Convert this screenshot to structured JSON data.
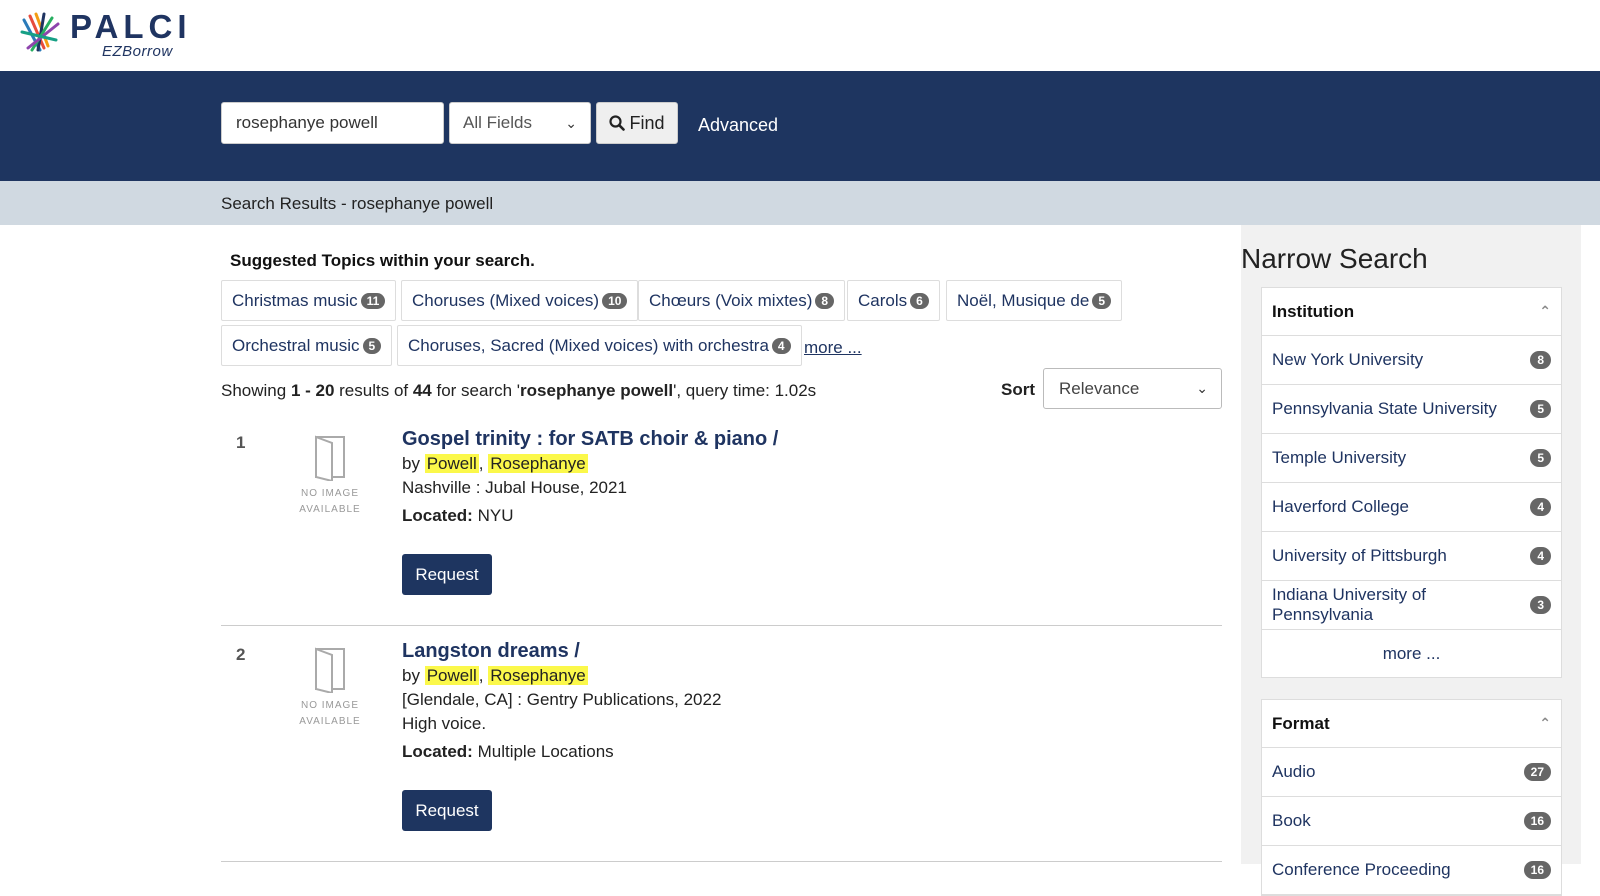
{
  "brand": {
    "title": "PALCI",
    "subtitle": "EZBorrow"
  },
  "search": {
    "query": "rosephanye powell",
    "field": "All Fields",
    "find_label": "Find",
    "advanced_label": "Advanced"
  },
  "breadcrumb": "Search Results - rosephanye powell",
  "suggested": {
    "title": "Suggested Topics within your search.",
    "topics": [
      {
        "label": "Christmas music",
        "count": "11"
      },
      {
        "label": "Choruses (Mixed voices)",
        "count": "10"
      },
      {
        "label": "Chœurs (Voix mixtes)",
        "count": "8"
      },
      {
        "label": "Carols",
        "count": "6"
      },
      {
        "label": "Noël, Musique de",
        "count": "5"
      },
      {
        "label": "Orchestral music",
        "count": "5"
      },
      {
        "label": "Choruses, Sacred (Mixed voices) with orchestra",
        "count": "4"
      }
    ],
    "more_label": "more ..."
  },
  "results_info": {
    "prefix": "Showing ",
    "range": "1 - 20",
    "mid": " results of ",
    "total": "44",
    "for_text": " for search '",
    "query": "rosephanye powell",
    "suffix": "', query time: 1.02s"
  },
  "sort": {
    "label": "Sort",
    "value": "Relevance"
  },
  "results": [
    {
      "num": "1",
      "title": "Gospel trinity : for SATB choir & piano /",
      "by": "by",
      "author_last": "Powell",
      "author_first": "Rosephanye",
      "publisher": "Nashville : Jubal House, 2021",
      "extra": "",
      "located_label": "Located:",
      "located": "NYU",
      "request_label": "Request",
      "no_image_line1": "NO IMAGE",
      "no_image_line2": "AVAILABLE"
    },
    {
      "num": "2",
      "title": "Langston dreams /",
      "by": "by",
      "author_last": "Powell",
      "author_first": "Rosephanye",
      "publisher": "[Glendale, CA] : Gentry Publications, 2022",
      "extra": "High voice.",
      "located_label": "Located:",
      "located": "Multiple Locations",
      "request_label": "Request",
      "no_image_line1": "NO IMAGE",
      "no_image_line2": "AVAILABLE"
    }
  ],
  "sidebar": {
    "title": "Narrow Search",
    "institution": {
      "heading": "Institution",
      "items": [
        {
          "label": "New York University",
          "count": "8"
        },
        {
          "label": "Pennsylvania State University",
          "count": "5"
        },
        {
          "label": "Temple University",
          "count": "5"
        },
        {
          "label": "Haverford College",
          "count": "4"
        },
        {
          "label": "University of Pittsburgh",
          "count": "4"
        },
        {
          "label": "Indiana University of Pennsylvania",
          "count": "3"
        }
      ],
      "more_label": "more ..."
    },
    "format": {
      "heading": "Format",
      "items": [
        {
          "label": "Audio",
          "count": "27"
        },
        {
          "label": "Book",
          "count": "16"
        },
        {
          "label": "Conference Proceeding",
          "count": "16"
        }
      ]
    }
  },
  "colors": {
    "navy": "#1e3560",
    "link": "#1f3461",
    "highlight": "#fbf84a",
    "crumb_bg": "#d0d9e1"
  }
}
